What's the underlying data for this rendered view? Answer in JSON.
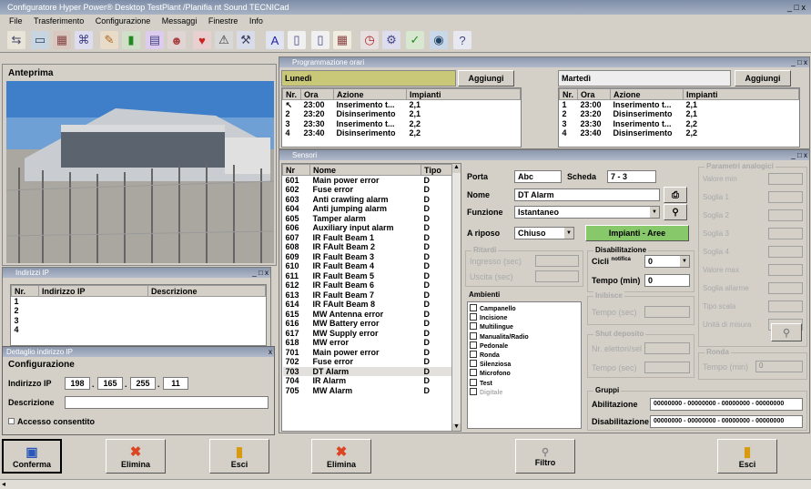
{
  "app": {
    "title": "Configuratore Hyper Power® Desktop TestPlant /Planifia nt Sound TECNICad",
    "menu": [
      "File",
      "Trasferimento",
      "Configurazione",
      "Messaggi",
      "Finestre",
      "Info"
    ],
    "toolbar_icons": [
      "flow-icon",
      "monitor-icon",
      "building-icon",
      "network-icon",
      "tools-icon",
      "battery-icon",
      "grid-icon",
      "users-icon",
      "heart-icon",
      "alarm-icon",
      "wrench-icon",
      "text-icon",
      "document-icon",
      "page-icon",
      "calendar-icon",
      "clock-icon",
      "settings-icon",
      "check-icon",
      "globe-icon",
      "help-icon"
    ],
    "controls": "_ □ x"
  },
  "preview": {
    "title": "Anteprima"
  },
  "ip_window": {
    "title": "Indirizzi IP",
    "headers": [
      "Nr.",
      "Indirizzo IP",
      "Descrizione"
    ],
    "rows": [
      "1",
      "2",
      "3",
      "4"
    ]
  },
  "ip_detail": {
    "title": "Dettaglio indirizzo IP",
    "section": "Configurazione",
    "ip_label": "Indirizzo IP",
    "ip": [
      "198",
      "165",
      "255",
      "11"
    ],
    "desc_label": "Descrizione",
    "desc_value": "",
    "checkbox_label": "Accesso consentito"
  },
  "schedule": {
    "title": "Programmazione orari",
    "day1": "Lunedì",
    "day2": "Martedì",
    "add": "Aggiungi",
    "headers": [
      "Nr.",
      "Ora",
      "Azione",
      "Impianti"
    ],
    "day1_rows": [
      {
        "nr": "",
        "ora": "23:00",
        "azione": "Inserimento t...",
        "imp": "2,1"
      },
      {
        "nr": "2",
        "ora": "23:20",
        "azione": "Disinserimento",
        "imp": "2,1"
      },
      {
        "nr": "3",
        "ora": "23:30",
        "azione": "Inserimento t...",
        "imp": "2,2"
      },
      {
        "nr": "4",
        "ora": "23:40",
        "azione": "Disinserimento",
        "imp": "2,2"
      }
    ],
    "day2_rows": [
      {
        "nr": "1",
        "ora": "23:00",
        "azione": "Inserimento t...",
        "imp": "2,1"
      },
      {
        "nr": "2",
        "ora": "23:20",
        "azione": "Disinserimento",
        "imp": "2,1"
      },
      {
        "nr": "3",
        "ora": "23:30",
        "azione": "Inserimento t...",
        "imp": "2,2"
      },
      {
        "nr": "4",
        "ora": "23:40",
        "azione": "Disinserimento",
        "imp": "2,2"
      }
    ]
  },
  "sensors": {
    "title": "Sensori",
    "headers": [
      "Nr",
      "Nome",
      "Tipo"
    ],
    "rows": [
      {
        "nr": "601",
        "nome": "Main power error",
        "tipo": "D"
      },
      {
        "nr": "602",
        "nome": "Fuse error",
        "tipo": "D"
      },
      {
        "nr": "603",
        "nome": "Anti crawling alarm",
        "tipo": "D"
      },
      {
        "nr": "604",
        "nome": "Anti jumping alarm",
        "tipo": "D"
      },
      {
        "nr": "605",
        "nome": "Tamper alarm",
        "tipo": "D"
      },
      {
        "nr": "606",
        "nome": "Auxiliary input alarm",
        "tipo": "D"
      },
      {
        "nr": "607",
        "nome": "IR Fault Beam 1",
        "tipo": "D"
      },
      {
        "nr": "608",
        "nome": "IR FAult Beam 2",
        "tipo": "D"
      },
      {
        "nr": "609",
        "nome": "IR Fault Beam 3",
        "tipo": "D"
      },
      {
        "nr": "610",
        "nome": "IR Fault Beam 4",
        "tipo": "D"
      },
      {
        "nr": "611",
        "nome": "IR Fault Beam 5",
        "tipo": "D"
      },
      {
        "nr": "612",
        "nome": "IR Fault Beam 6",
        "tipo": "D"
      },
      {
        "nr": "613",
        "nome": "IR Fault Beam 7",
        "tipo": "D"
      },
      {
        "nr": "614",
        "nome": "IR FAult Beam 8",
        "tipo": "D"
      },
      {
        "nr": "615",
        "nome": "MW Antenna error",
        "tipo": "D"
      },
      {
        "nr": "616",
        "nome": "MW Battery error",
        "tipo": "D"
      },
      {
        "nr": "617",
        "nome": "MW Supply error",
        "tipo": "D"
      },
      {
        "nr": "618",
        "nome": "MW error",
        "tipo": "D"
      },
      {
        "nr": "701",
        "nome": "Main power error",
        "tipo": "D"
      },
      {
        "nr": "702",
        "nome": "Fuse error",
        "tipo": "D"
      },
      {
        "nr": "703",
        "nome": "DT Alarm",
        "tipo": "D"
      },
      {
        "nr": "704",
        "nome": "IR Alarm",
        "tipo": "D"
      },
      {
        "nr": "705",
        "nome": "MW Alarm",
        "tipo": "D"
      }
    ],
    "selected_index": 20
  },
  "detail": {
    "porta_label": "Porta",
    "porta": "Abc",
    "scheda_label": "Scheda",
    "scheda": "7 - 3",
    "nome_label": "Nome",
    "nome": "DT Alarm",
    "funzione_label": "Funzione",
    "funzione": "Istantaneo",
    "riposo_label": "A riposo",
    "riposo": "Chiuso",
    "impianti_button": "Impianti - Aree",
    "ritardi_title": "Ritardi",
    "ingresso_label": "Ingresso (sec)",
    "uscita_label": "Uscita (sec)",
    "ambienti_title": "Ambienti",
    "ambienti": [
      "Campanello",
      "Incisione",
      "Multilingue",
      "Manualita/Radio",
      "Pedonale",
      "Ronda",
      "Silenziosa",
      "Microfono",
      "Test",
      "Digitale"
    ],
    "ambienti_disabled_index": 9,
    "disab_title": "Disabilitazione",
    "cicli_label": "Cicli",
    "cicli_sup": "notifica",
    "cicli_value": "0",
    "tempo_label": "Tempo (min)",
    "tempo_value": "0",
    "inibisce_title": "Inibisce",
    "inibisce_tempo": "Tempo (sec)",
    "shut_title": "Shut deposito",
    "shut_sel_label": "Nr. elettori/sel",
    "shut_tempo": "Tempo (sec)",
    "analog_title": "Parametri analogici",
    "analog": [
      "Valore min",
      "Soglia 1",
      "Soglia 2",
      "Soglia 3",
      "Soglia 4",
      "Valore max",
      "Soglia allarme",
      "Tipo scala",
      "Unità di misura"
    ],
    "ronda_title": "Ronda",
    "ronda_tempo": "Tempo (min)",
    "ronda_value": "0",
    "gruppi_title": "Gruppi",
    "abilitazione_label": "Abilitazione",
    "abilitazione_value": "00000000 - 00000000 - 00000000 - 00000000",
    "disabilitazione_label": "Disabilitazione",
    "disabilitazione_value": "00000000 - 00000000 - 00000000 - 00000000"
  },
  "buttons": {
    "conferma": "Conferma",
    "elimina": "Elimina",
    "esci": "Esci",
    "elimina2": "Elimina",
    "filtro": "Filtro",
    "esci2": "Esci"
  }
}
